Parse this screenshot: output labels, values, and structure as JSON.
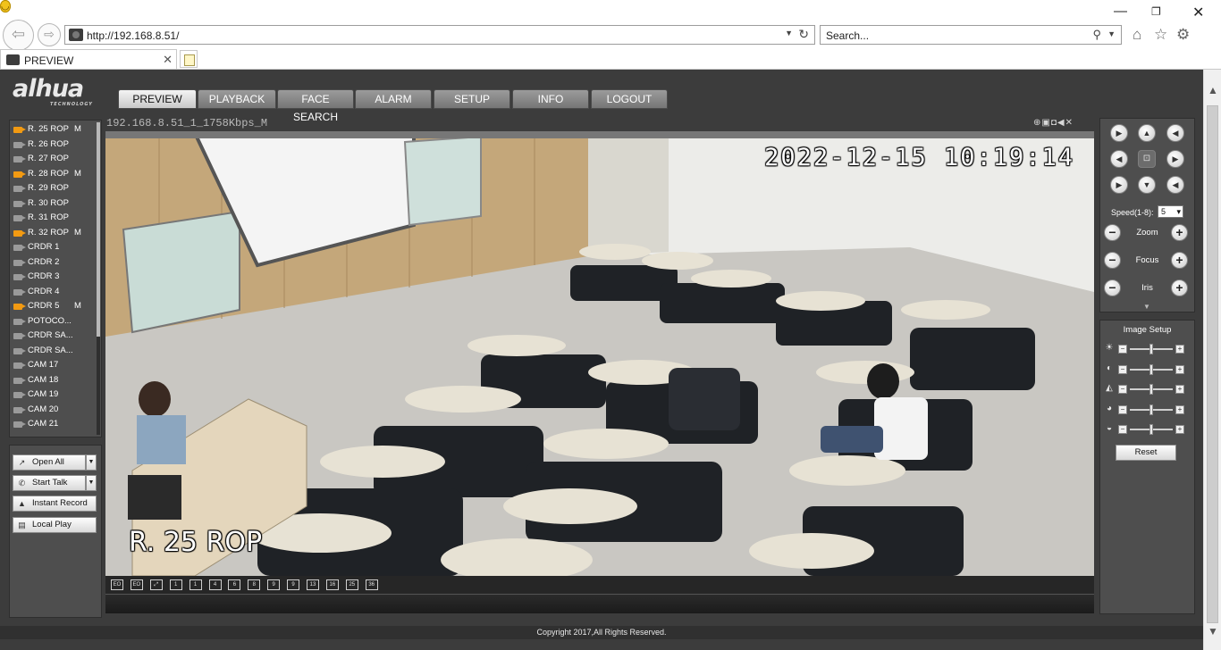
{
  "browser": {
    "address": "http://192.168.8.51/",
    "search_placeholder": "Search...",
    "tab_title": "PREVIEW"
  },
  "app": {
    "logo_text": "alhua",
    "logo_sub": "TECHNOLOGY",
    "nav_tabs": [
      {
        "label": "PREVIEW",
        "active": true
      },
      {
        "label": "PLAYBACK",
        "active": false
      },
      {
        "label": "FACE SEARCH",
        "active": false
      },
      {
        "label": "ALARM",
        "active": false
      },
      {
        "label": "SETUP",
        "active": false
      },
      {
        "label": "INFO",
        "active": false
      },
      {
        "label": "LOGOUT",
        "active": false
      }
    ],
    "channels": [
      {
        "name": "R. 25 ROP",
        "mark": "M",
        "live": true
      },
      {
        "name": "R. 26 ROP",
        "mark": "",
        "live": false
      },
      {
        "name": "R. 27 ROP",
        "mark": "",
        "live": false
      },
      {
        "name": "R. 28 ROP",
        "mark": "M",
        "live": true
      },
      {
        "name": "R. 29 ROP",
        "mark": "",
        "live": false
      },
      {
        "name": "R. 30 ROP",
        "mark": "",
        "live": false
      },
      {
        "name": "R. 31 ROP",
        "mark": "",
        "live": false
      },
      {
        "name": "R. 32 ROP",
        "mark": "M",
        "live": true
      },
      {
        "name": "CRDR 1",
        "mark": "",
        "live": false
      },
      {
        "name": "CRDR 2",
        "mark": "",
        "live": false
      },
      {
        "name": "CRDR 3",
        "mark": "",
        "live": false
      },
      {
        "name": "CRDR 4",
        "mark": "",
        "live": false
      },
      {
        "name": "CRDR 5",
        "mark": "M",
        "live": true
      },
      {
        "name": "POTOCO...",
        "mark": "",
        "live": false
      },
      {
        "name": "CRDR SA...",
        "mark": "",
        "live": false
      },
      {
        "name": "CRDR SA...",
        "mark": "",
        "live": false
      },
      {
        "name": "CAM 17",
        "mark": "",
        "live": false
      },
      {
        "name": "CAM 18",
        "mark": "",
        "live": false
      },
      {
        "name": "CAM 19",
        "mark": "",
        "live": false
      },
      {
        "name": "CAM 20",
        "mark": "",
        "live": false
      },
      {
        "name": "CAM 21",
        "mark": "",
        "live": false
      }
    ],
    "buttons": {
      "open_all": "Open All",
      "start_talk": "Start Talk",
      "instant_record": "Instant Record",
      "local_play": "Local Play"
    },
    "video": {
      "stream_title": "192.168.8.51_1_1758Kbps_M",
      "osd_time": "2022-12-15 10:19:14",
      "osd_name": "R. 25 ROP"
    },
    "layout_buttons": [
      "EO",
      "EO",
      "⤢",
      "1",
      "1",
      "4",
      "6",
      "8",
      "9",
      "9",
      "13",
      "16",
      "25",
      "36"
    ],
    "ptz": {
      "speed_label": "Speed(1-8):",
      "speed_value": "5",
      "zoom_label": "Zoom",
      "focus_label": "Focus",
      "iris_label": "Iris"
    },
    "image_setup": {
      "title": "Image Setup",
      "sliders": [
        {
          "icon": "brightness-icon",
          "level": 0.5
        },
        {
          "icon": "contrast-icon",
          "level": 0.5
        },
        {
          "icon": "saturation-icon",
          "level": 0.5
        },
        {
          "icon": "hue-icon",
          "level": 0.5
        },
        {
          "icon": "sharpness-icon",
          "level": 0.5
        }
      ],
      "reset_label": "Reset"
    },
    "footer": "Copyright 2017,All Rights Reserved."
  }
}
